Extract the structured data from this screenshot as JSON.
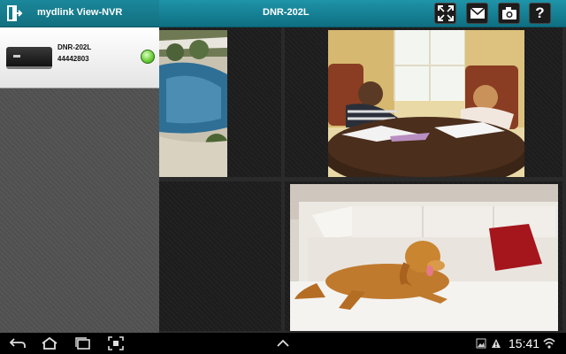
{
  "app_title": "mydlink View-NVR",
  "device_title": "DNR-202L",
  "toolbar": {
    "buttons": [
      {
        "name": "fullscreen-button",
        "icon": "fullscreen-icon"
      },
      {
        "name": "mail-button",
        "icon": "mail-icon"
      },
      {
        "name": "snapshot-button",
        "icon": "camera-icon"
      },
      {
        "name": "help-button",
        "icon": "help-icon",
        "label": "?"
      }
    ]
  },
  "sidebar": {
    "devices": [
      {
        "name": "DNR-202L",
        "id": "44442803",
        "status": "online",
        "status_color": "#6fcf3c"
      }
    ]
  },
  "cameras": [
    {
      "position": "top-left",
      "content": "feed"
    },
    {
      "position": "top-right",
      "content": "feed"
    },
    {
      "position": "bottom-left",
      "content": "empty"
    },
    {
      "position": "bottom-right",
      "content": "feed"
    }
  ],
  "statusbar": {
    "time": "15:41",
    "nav_icons": [
      "back-icon",
      "home-icon",
      "recent-apps-icon",
      "screenshot-icon",
      "chevron-up-icon"
    ],
    "status_icons": [
      "image-icon",
      "warning-icon",
      "wifi-icon"
    ]
  },
  "colors": {
    "topbar": "#157f93",
    "accent_online": "#6fcf3c"
  }
}
